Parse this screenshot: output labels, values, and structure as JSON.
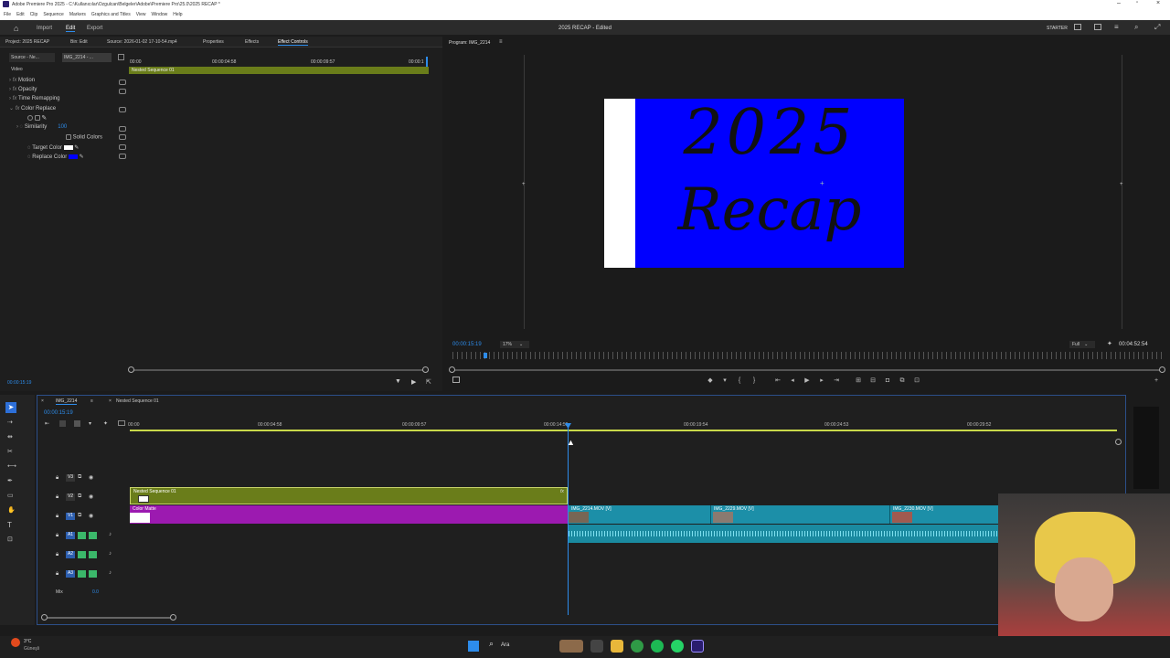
{
  "titlebar": {
    "text": "Adobe Premiere Pro 2025 - C:\\Kullanıcılar\\Ozgulcan\\Belgeler\\Adobe\\Premiere Pro\\25.0\\2025 RECAP *"
  },
  "menu": [
    "File",
    "Edit",
    "Clip",
    "Sequence",
    "Markers",
    "Graphics and Titles",
    "View",
    "Window",
    "Help"
  ],
  "workspace": {
    "tabs": [
      "Import",
      "Edit",
      "Export"
    ],
    "active": "Edit",
    "title": "2025 RECAP - Edited",
    "starter": "STARTER"
  },
  "left_tabs": [
    "Project: 2025 RECAP",
    "Bin: Edit",
    "Source: 2026-01-02 17-10-54.mp4",
    "Properties",
    "Effects",
    "Effect Controls"
  ],
  "effect_controls": {
    "source_tab": "Source - Ne...",
    "clip_tab": "IMG_2214 - ...",
    "section": "Video",
    "timecodes": [
      "00:00",
      "00:00:04:58",
      "00:00:09:57",
      "00:00:1"
    ],
    "clip_label": "Nested Sequence 01",
    "props": [
      "Motion",
      "Opacity",
      "Time Remapping",
      "Color Replace"
    ],
    "similarity_label": "Similarity",
    "similarity_value": "100",
    "solid_colors": "Solid Colors",
    "target_color": "Target Color",
    "replace_color": "Replace Color",
    "footer_timecode": "00:00:15:19"
  },
  "program": {
    "tab": "Program: IMG_2214",
    "line1": "2025",
    "line2": "Recap",
    "timecode": "00:00:15:19",
    "zoom": "17%",
    "quality": "Full",
    "duration": "00:04:52:54",
    "bg_color": "#0000ff"
  },
  "timeline": {
    "tabs": [
      "IMG_2214",
      "Nested Sequence 01"
    ],
    "timecode": "00:00:15:19",
    "ruler": [
      "00:00",
      "00:00:04:58",
      "00:00:09:57",
      "00:00:14:56",
      "00:00:19:54",
      "00:00:24:53",
      "00:00:29:52"
    ],
    "tracks": [
      "V3",
      "V2",
      "V1",
      "A1",
      "A2",
      "A3",
      "Mix"
    ],
    "mix_value": "0.0",
    "clips": {
      "nested": "Nested Sequence 01",
      "matte": "Color Matte",
      "c1": "IMG_2214.MOV [V]",
      "c2": "IMG_2229.MOV [V]",
      "c3": "IMG_2230.MOV [V]"
    }
  },
  "taskbar": {
    "weather_temp": "3°C",
    "weather_desc": "Güneşli",
    "search": "Ara"
  }
}
